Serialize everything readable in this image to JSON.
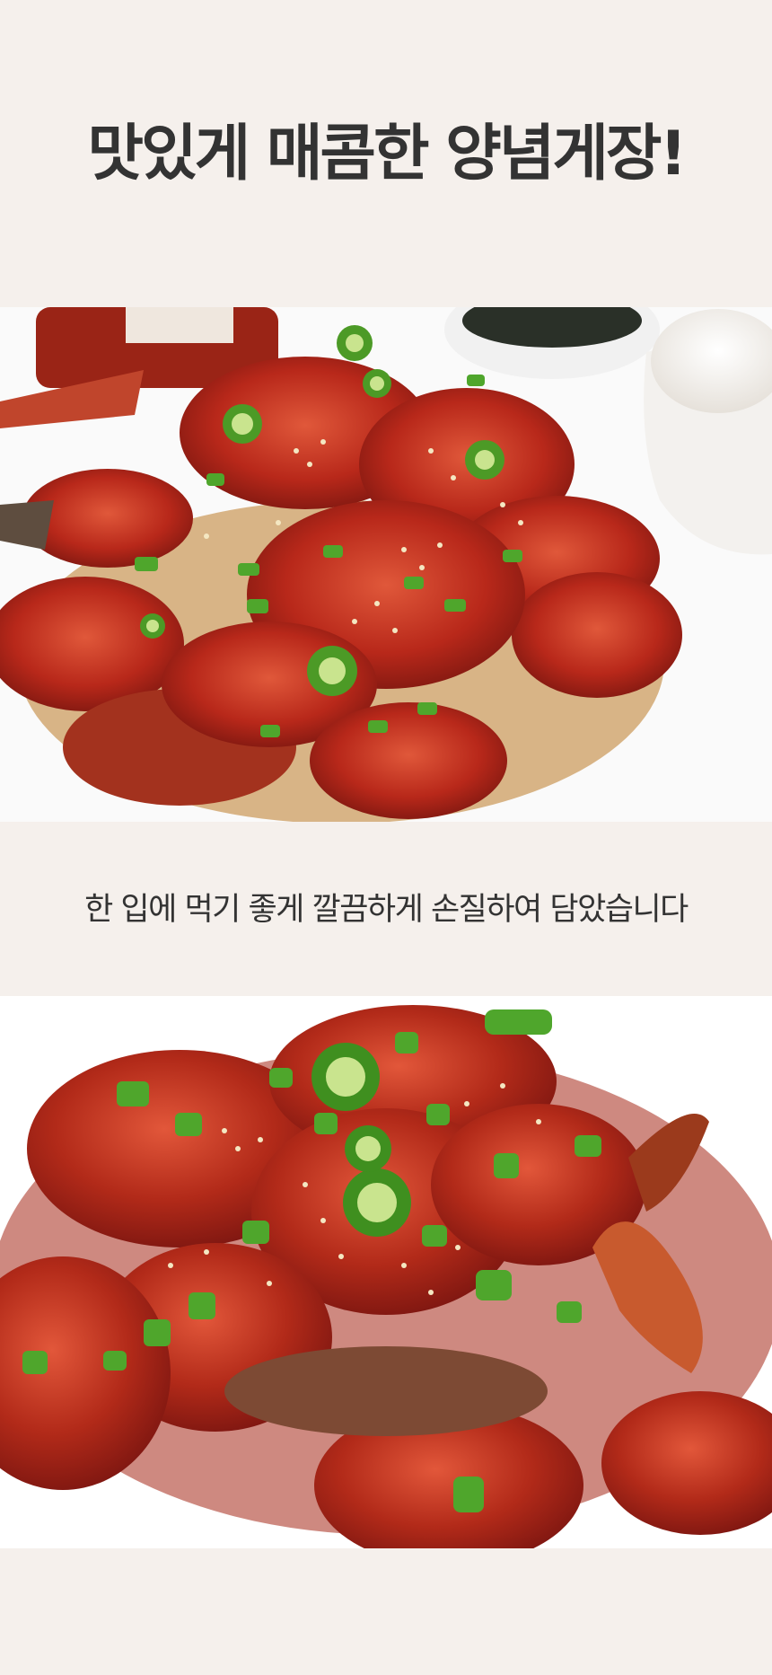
{
  "headline": "맛있게 매콤한 양념게장!",
  "caption": "한 입에 먹기 좋게 깔끔하게 손질하여 담았습니다",
  "colors": {
    "background": "#f5f0ec",
    "text": "#333333",
    "sauce": "#b8281a",
    "sauce_highlight": "#e0583a",
    "scallion": "#4fa62c",
    "board": "#d8b486"
  },
  "images": [
    {
      "name": "crab-plate-photo",
      "alt": "spicy marinated crab on wooden board with rice and seaweed"
    },
    {
      "name": "crab-closeup-photo",
      "alt": "close-up of spicy marinated crab pieces with green onion and pepper"
    }
  ]
}
